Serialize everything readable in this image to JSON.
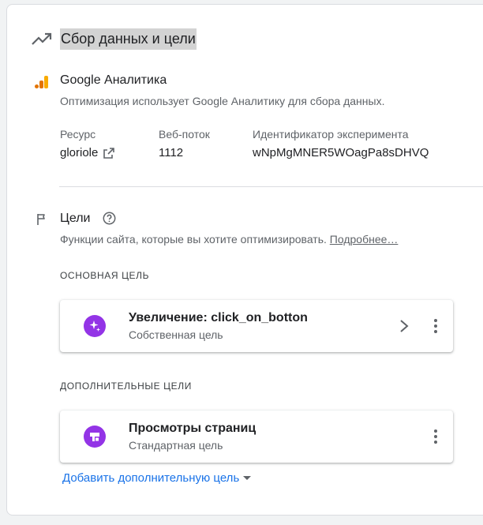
{
  "section": {
    "title": "Сбор данных и цели"
  },
  "analytics": {
    "title": "Google Аналитика",
    "description": "Оптимизация использует Google Аналитику для сбора данных.",
    "resource_label": "Ресурс",
    "resource_value": "gloriole",
    "stream_label": "Веб-поток",
    "stream_value": "1112",
    "experiment_label": "Идентификатор эксперимента",
    "experiment_value": "wNpMgMNER5WOagPa8sDHVQ"
  },
  "goals": {
    "title": "Цели",
    "description": "Функции сайта, которые вы хотите оптимизировать.",
    "learn_more": "Подробнее…",
    "primary_heading": "ОСНОВНАЯ ЦЕЛЬ",
    "primary": {
      "title": "Увеличение: click_on_botton",
      "subtitle": "Собственная цель"
    },
    "additional_heading": "ДОПОЛНИТЕЛЬНЫЕ ЦЕЛИ",
    "additional": [
      {
        "title": "Просмотры страниц",
        "subtitle": "Стандартная цель"
      }
    ],
    "add_button": "Добавить дополнительную цель"
  },
  "colors": {
    "goal_icon": "#9334e6",
    "ga_orange": "#f9ab00",
    "ga_dark": "#e37400",
    "link": "#1a73e8"
  },
  "icons": {
    "section": "trending-up-icon",
    "analytics": "google-analytics-icon",
    "resource_link": "open-in-new-icon",
    "goals": "flag-icon",
    "help": "help-icon",
    "primary_goal": "sparkle-icon",
    "additional_goal": "pageview-icon",
    "chevron": "chevron-right-icon",
    "more": "more-vert-icon",
    "dropdown": "arrow-drop-down-icon"
  }
}
